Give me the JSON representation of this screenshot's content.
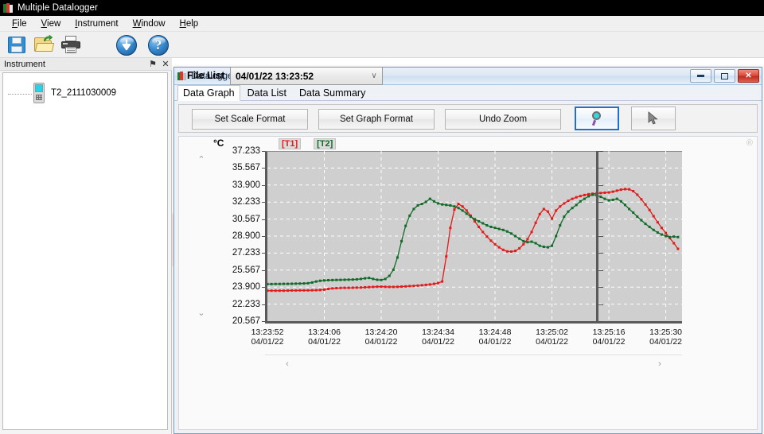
{
  "window": {
    "title": "Multiple Datalogger",
    "icon": "datalogger-icon"
  },
  "menu": {
    "items": [
      {
        "label": "File",
        "accel": "F"
      },
      {
        "label": "View",
        "accel": "V"
      },
      {
        "label": "Instrument",
        "accel": "I"
      },
      {
        "label": "Window",
        "accel": "W"
      },
      {
        "label": "Help",
        "accel": "H"
      }
    ]
  },
  "toolbar": {
    "buttons": [
      {
        "name": "save-icon",
        "title": "Save"
      },
      {
        "name": "open-folder-icon",
        "title": "Open"
      },
      {
        "name": "print-icon",
        "title": "Print"
      },
      {
        "name": "download-icon",
        "title": "Download"
      },
      {
        "name": "help-icon",
        "title": "Help",
        "glyph": "?"
      }
    ],
    "file_list_label": "File List",
    "file_list_value": "04/01/22 13:23:52",
    "file_list_chevron": "∨"
  },
  "dock": {
    "title": "Instrument",
    "pin_glyph": "⚑",
    "close_glyph": "✕",
    "tree": [
      {
        "label": "T2_2111030009",
        "icon": "device-icon"
      }
    ]
  },
  "child_window": {
    "title": "Datalogger7",
    "minimize_glyph": "–",
    "maximize_glyph": "□",
    "close_glyph": "✕",
    "tabs": [
      {
        "label": "Data Graph",
        "active": true
      },
      {
        "label": "Data List",
        "active": false
      },
      {
        "label": "Data Summary",
        "active": false
      }
    ],
    "controls": {
      "set_scale_format": "Set Scale Format",
      "set_graph_format": "Set Graph Format",
      "undo_zoom": "Undo Zoom",
      "zoom_tool": "zoom-tool",
      "cursor_tool": "cursor-tool",
      "zoom_tool_selected": true
    },
    "scroll": {
      "up_glyph": "⌃",
      "down_glyph": "⌄",
      "left_glyph": "‹",
      "right_glyph": "›"
    },
    "registered_mark": "®"
  },
  "chart_data": {
    "type": "line",
    "title": "",
    "unit_label": "°C",
    "xlabel": "",
    "ylabel": "°C",
    "ylim": [
      20.567,
      37.233
    ],
    "yticks": [
      37.233,
      35.567,
      33.9,
      32.233,
      30.567,
      28.9,
      27.233,
      25.567,
      23.9,
      22.233,
      20.567
    ],
    "ytick_labels": [
      "37.233",
      "35.567",
      "33.900",
      "32.233",
      "30.567",
      "28.900",
      "27.233",
      "25.567",
      "23.900",
      "22.233",
      "20.567"
    ],
    "xticks": [
      0,
      14,
      28,
      42,
      56,
      70,
      84,
      98
    ],
    "xtick_labels": [
      {
        "time": "13:23:52",
        "date": "04/01/22"
      },
      {
        "time": "13:24:06",
        "date": "04/01/22"
      },
      {
        "time": "13:24:20",
        "date": "04/01/22"
      },
      {
        "time": "13:24:34",
        "date": "04/01/22"
      },
      {
        "time": "13:24:48",
        "date": "04/01/22"
      },
      {
        "time": "13:25:02",
        "date": "04/01/22"
      },
      {
        "time": "13:25:16",
        "date": "04/01/22"
      },
      {
        "time": "13:25:30",
        "date": "04/01/22"
      }
    ],
    "xlim": [
      0,
      102
    ],
    "grid": true,
    "grid_color": "#ffffff",
    "plot_bg": "#cfcfcf",
    "legend": [
      {
        "name": "T1",
        "label": "[T1]",
        "color": "#e11b1b"
      },
      {
        "name": "T2",
        "label": "[T2]",
        "color": "#0f6b28"
      }
    ],
    "legend_position": "top-left",
    "marker": "square",
    "series": [
      {
        "name": "T1",
        "color": "#e11b1b",
        "x": [
          0,
          1,
          2,
          3,
          4,
          5,
          6,
          7,
          8,
          9,
          10,
          11,
          12,
          13,
          14,
          15,
          16,
          17,
          18,
          19,
          20,
          21,
          22,
          23,
          24,
          25,
          26,
          27,
          28,
          29,
          30,
          31,
          32,
          33,
          34,
          35,
          36,
          37,
          38,
          39,
          40,
          41,
          42,
          43,
          44,
          45,
          46,
          47,
          48,
          49,
          50,
          51,
          52,
          53,
          54,
          55,
          56,
          57,
          58,
          59,
          60,
          61,
          62,
          63,
          64,
          65,
          66,
          67,
          68,
          69,
          70,
          71,
          72,
          73,
          74,
          75,
          76,
          77,
          78,
          79,
          80,
          81,
          82,
          83,
          84,
          85,
          86,
          87,
          88,
          89,
          90,
          91,
          92,
          93,
          94,
          95,
          96,
          97,
          98,
          99,
          100,
          101
        ],
        "y": [
          23.55,
          23.55,
          23.55,
          23.55,
          23.55,
          23.56,
          23.57,
          23.57,
          23.58,
          23.58,
          23.58,
          23.59,
          23.6,
          23.62,
          23.65,
          23.72,
          23.78,
          23.8,
          23.82,
          23.83,
          23.83,
          23.84,
          23.85,
          23.86,
          23.88,
          23.9,
          23.92,
          23.94,
          23.95,
          23.93,
          23.92,
          23.92,
          23.93,
          23.95,
          23.97,
          24.0,
          24.02,
          24.05,
          24.08,
          24.12,
          24.16,
          24.22,
          24.3,
          24.45,
          26.9,
          29.7,
          31.5,
          32.05,
          31.8,
          31.4,
          30.9,
          30.35,
          29.8,
          29.3,
          28.85,
          28.45,
          28.1,
          27.8,
          27.55,
          27.4,
          27.38,
          27.45,
          27.7,
          28.1,
          28.6,
          29.3,
          30.2,
          31.05,
          31.55,
          31.3,
          30.6,
          31.4,
          31.8,
          32.1,
          32.35,
          32.55,
          32.7,
          32.82,
          32.92,
          33.0,
          33.05,
          33.08,
          33.12,
          33.15,
          33.18,
          33.25,
          33.35,
          33.45,
          33.5,
          33.48,
          33.3,
          32.95,
          32.5,
          32.0,
          31.45,
          30.85,
          30.25,
          29.7,
          29.2,
          28.7,
          28.2,
          27.65
        ],
        "marker_count": 102
      },
      {
        "name": "T2",
        "color": "#0f6b28",
        "x": [
          0,
          1,
          2,
          3,
          4,
          5,
          6,
          7,
          8,
          9,
          10,
          11,
          12,
          13,
          14,
          15,
          16,
          17,
          18,
          19,
          20,
          21,
          22,
          23,
          24,
          25,
          26,
          27,
          28,
          29,
          30,
          31,
          32,
          33,
          34,
          35,
          36,
          37,
          38,
          39,
          40,
          41,
          42,
          43,
          44,
          45,
          46,
          47,
          48,
          49,
          50,
          51,
          52,
          53,
          54,
          55,
          56,
          57,
          58,
          59,
          60,
          61,
          62,
          63,
          64,
          65,
          66,
          67,
          68,
          69,
          70,
          71,
          72,
          73,
          74,
          75,
          76,
          77,
          78,
          79,
          80,
          81,
          82,
          83,
          84,
          85,
          86,
          87,
          88,
          89,
          90,
          91,
          92,
          93,
          94,
          95,
          96,
          97,
          98,
          99,
          100,
          101
        ],
        "y": [
          24.2,
          24.2,
          24.21,
          24.21,
          24.22,
          24.22,
          24.23,
          24.24,
          24.25,
          24.26,
          24.28,
          24.35,
          24.45,
          24.52,
          24.56,
          24.58,
          24.59,
          24.6,
          24.61,
          24.62,
          24.63,
          24.64,
          24.66,
          24.7,
          24.76,
          24.8,
          24.7,
          24.62,
          24.6,
          24.7,
          25.0,
          25.6,
          26.8,
          28.4,
          29.9,
          30.9,
          31.55,
          31.9,
          32.05,
          32.25,
          32.55,
          32.3,
          32.1,
          32.0,
          31.95,
          31.9,
          31.8,
          31.65,
          31.4,
          31.1,
          30.8,
          30.55,
          30.35,
          30.15,
          29.95,
          29.8,
          29.7,
          29.6,
          29.5,
          29.35,
          29.15,
          28.9,
          28.65,
          28.4,
          28.3,
          28.35,
          28.2,
          27.95,
          27.85,
          27.8,
          27.95,
          28.9,
          29.95,
          30.8,
          31.3,
          31.65,
          31.95,
          32.3,
          32.55,
          32.8,
          32.95,
          32.9,
          32.75,
          32.55,
          32.4,
          32.45,
          32.55,
          32.3,
          31.95,
          31.55,
          31.2,
          30.8,
          30.45,
          30.1,
          29.8,
          29.5,
          29.25,
          29.05,
          28.9,
          28.8,
          28.85,
          28.8
        ],
        "marker_count": 102
      }
    ]
  }
}
